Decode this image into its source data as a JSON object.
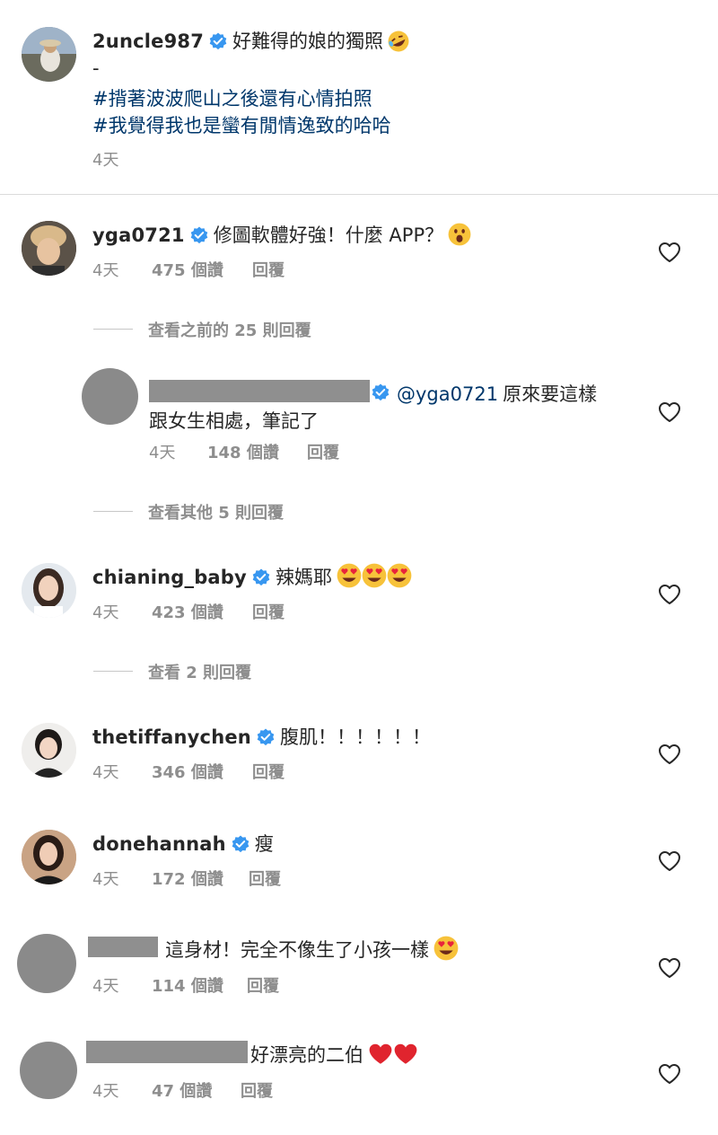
{
  "post": {
    "author": "2uncle987",
    "caption": "好難得的娘的獨照",
    "dash": "-",
    "hashtag1": "#揹著波波爬山之後還有心情拍照",
    "hashtag2": "#我覺得我也是蠻有閒情逸致的哈哈",
    "time": "4天"
  },
  "comments": [
    {
      "user": "yga0721",
      "text": "修圖軟體好強！什麼 APP？",
      "time": "4天",
      "likes": "475 個讚",
      "reply": "回覆"
    },
    {
      "user": "",
      "mention": "@yga0721",
      "text_line1": "原來要這樣",
      "text_line2": "跟女生相處，筆記了",
      "time": "4天",
      "likes": "148 個讚",
      "reply": "回覆"
    },
    {
      "user": "chianing_baby",
      "text": "辣媽耶",
      "time": "4天",
      "likes": "423 個讚",
      "reply": "回覆"
    },
    {
      "user": "thetiffanychen",
      "text": "腹肌！！！！！！",
      "time": "4天",
      "likes": "346 個讚",
      "reply": "回覆"
    },
    {
      "user": "donehannah",
      "text": "瘦",
      "time": "4天",
      "likes": "172 個讚",
      "reply": "回覆"
    },
    {
      "user": "",
      "text": "這身材！完全不像生了小孩一樣",
      "time": "4天",
      "likes": "114 個讚",
      "reply": "回覆"
    },
    {
      "user": "",
      "text": "好漂亮的二伯",
      "time": "4天",
      "likes": "47 個讚",
      "reply": "回覆"
    }
  ],
  "view_replies": {
    "prev": "查看之前的 25 則回覆",
    "other": "查看其他 5 則回覆",
    "two": "查看 2 則回覆"
  },
  "colors": {
    "verified": "#3897f0",
    "meta": "#8e8e8e",
    "hashtag": "#00376b",
    "heart": "#262626"
  }
}
